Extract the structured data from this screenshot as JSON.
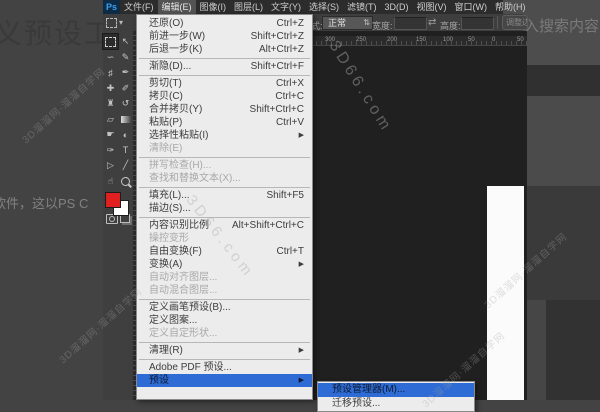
{
  "page": {
    "left_title": "义预设工",
    "left_paragraph": "软件，这以PS C",
    "search_text": "入搜索内容"
  },
  "menubar": {
    "logo": "Ps",
    "items": [
      {
        "label": "文件(F)",
        "active": false
      },
      {
        "label": "编辑(E)",
        "active": true
      },
      {
        "label": "图像(I)",
        "active": false
      },
      {
        "label": "图层(L)",
        "active": false
      },
      {
        "label": "文字(Y)",
        "active": false
      },
      {
        "label": "选择(S)",
        "active": false
      },
      {
        "label": "滤镜(T)",
        "active": false
      },
      {
        "label": "3D(D)",
        "active": false
      },
      {
        "label": "视图(V)",
        "active": false
      },
      {
        "label": "窗口(W)",
        "active": false
      },
      {
        "label": "帮助(H)",
        "active": false
      }
    ]
  },
  "options_bar": {
    "style_label": "式:",
    "style_value": "正常",
    "spinner_icon": "⇅",
    "width_label": "宽度:",
    "width_value": "",
    "swap_icon": "⇄",
    "height_label": "高度:",
    "height_value": "",
    "refine_edge_label": "调整边缘...",
    "tool_preset_arrow": "▾"
  },
  "toolbar": {
    "foreground_color": "#e01f1f",
    "background_color": "#ffffff",
    "tools": [
      {
        "name": "rect-marquee-tool",
        "icon": "marquee",
        "glyph": "",
        "selected": true
      },
      {
        "name": "move-tool",
        "icon": "glyph",
        "glyph": "↖",
        "selected": false
      },
      {
        "name": "lasso-tool",
        "icon": "glyph",
        "glyph": "∽",
        "selected": false
      },
      {
        "name": "quick-select-tool",
        "icon": "glyph",
        "glyph": "✎",
        "selected": false
      },
      {
        "name": "crop-tool",
        "icon": "glyph",
        "glyph": "♯",
        "selected": false
      },
      {
        "name": "eyedropper-tool",
        "icon": "glyph",
        "glyph": "✒",
        "selected": false
      },
      {
        "name": "healing-brush-tool",
        "icon": "glyph",
        "glyph": "✚",
        "selected": false
      },
      {
        "name": "brush-tool",
        "icon": "glyph",
        "glyph": "✐",
        "selected": false
      },
      {
        "name": "clone-stamp-tool",
        "icon": "glyph",
        "glyph": "♜",
        "selected": false
      },
      {
        "name": "history-brush-tool",
        "icon": "glyph",
        "glyph": "↺",
        "selected": false
      },
      {
        "name": "eraser-tool",
        "icon": "glyph",
        "glyph": "▱",
        "selected": false
      },
      {
        "name": "gradient-tool",
        "icon": "gradient",
        "glyph": "",
        "selected": false
      },
      {
        "name": "smudge-tool",
        "icon": "glyph",
        "glyph": "☛",
        "selected": false
      },
      {
        "name": "dodge-tool",
        "icon": "glyph",
        "glyph": "◐",
        "selected": false
      },
      {
        "name": "pen-tool",
        "icon": "glyph",
        "glyph": "✑",
        "selected": false
      },
      {
        "name": "type-tool",
        "icon": "glyph",
        "glyph": "T",
        "selected": false
      },
      {
        "name": "path-select-tool",
        "icon": "glyph",
        "glyph": "▷",
        "selected": false
      },
      {
        "name": "shape-tool",
        "icon": "glyph",
        "glyph": "╱",
        "selected": false
      },
      {
        "name": "hand-tool",
        "icon": "glyph",
        "glyph": "☝",
        "selected": false
      },
      {
        "name": "zoom-tool",
        "icon": "zoom",
        "glyph": "",
        "selected": false
      }
    ]
  },
  "ruler": {
    "labels": [
      "300",
      "250",
      "200",
      "150",
      "100",
      "50",
      "0",
      "50"
    ]
  },
  "edit_menu": {
    "items": [
      {
        "label": "还原(O)",
        "shortcut": "Ctrl+Z"
      },
      {
        "label": "前进一步(W)",
        "shortcut": "Shift+Ctrl+Z"
      },
      {
        "label": "后退一步(K)",
        "shortcut": "Alt+Ctrl+Z"
      },
      {
        "separator": true
      },
      {
        "label": "渐隐(D)...",
        "shortcut": "Shift+Ctrl+F"
      },
      {
        "separator": true
      },
      {
        "label": "剪切(T)",
        "shortcut": "Ctrl+X"
      },
      {
        "label": "拷贝(C)",
        "shortcut": "Ctrl+C"
      },
      {
        "label": "合并拷贝(Y)",
        "shortcut": "Shift+Ctrl+C"
      },
      {
        "label": "粘贴(P)",
        "shortcut": "Ctrl+V"
      },
      {
        "label": "选择性粘贴(I)",
        "submenu": true
      },
      {
        "label": "清除(E)",
        "disabled": true
      },
      {
        "separator": true
      },
      {
        "label": "拼写检查(H)...",
        "disabled": true
      },
      {
        "label": "查找和替换文本(X)...",
        "disabled": true
      },
      {
        "separator": true
      },
      {
        "label": "填充(L)...",
        "shortcut": "Shift+F5"
      },
      {
        "label": "描边(S)..."
      },
      {
        "separator": true
      },
      {
        "label": "内容识别比例",
        "shortcut": "Alt+Shift+Ctrl+C"
      },
      {
        "label": "操控变形",
        "disabled": true
      },
      {
        "label": "自由变换(F)",
        "shortcut": "Ctrl+T"
      },
      {
        "label": "变换(A)",
        "submenu": true
      },
      {
        "label": "自动对齐图层...",
        "disabled": true
      },
      {
        "label": "自动混合图层...",
        "disabled": true
      },
      {
        "separator": true
      },
      {
        "label": "定义画笔预设(B)..."
      },
      {
        "label": "定义图案..."
      },
      {
        "label": "定义自定形状...",
        "disabled": true
      },
      {
        "separator": true
      },
      {
        "label": "清理(R)",
        "submenu": true
      },
      {
        "separator": true
      },
      {
        "label": "Adobe PDF 预设..."
      },
      {
        "label": "预设",
        "submenu": true,
        "highlighted": true
      }
    ]
  },
  "flyout": {
    "items": [
      {
        "label": "预设管理器(M)...",
        "highlighted": true
      },
      {
        "label": "迁移预设...",
        "highlighted": false
      }
    ]
  },
  "watermarks": {
    "site": "3D66.com",
    "brand": "3D溜溜网·溜溜自学网"
  },
  "colors": {
    "menu_highlight": "#2e6bd4",
    "foreground_swatch": "#e01f1f",
    "logo_blue": "#3ba2f3"
  }
}
